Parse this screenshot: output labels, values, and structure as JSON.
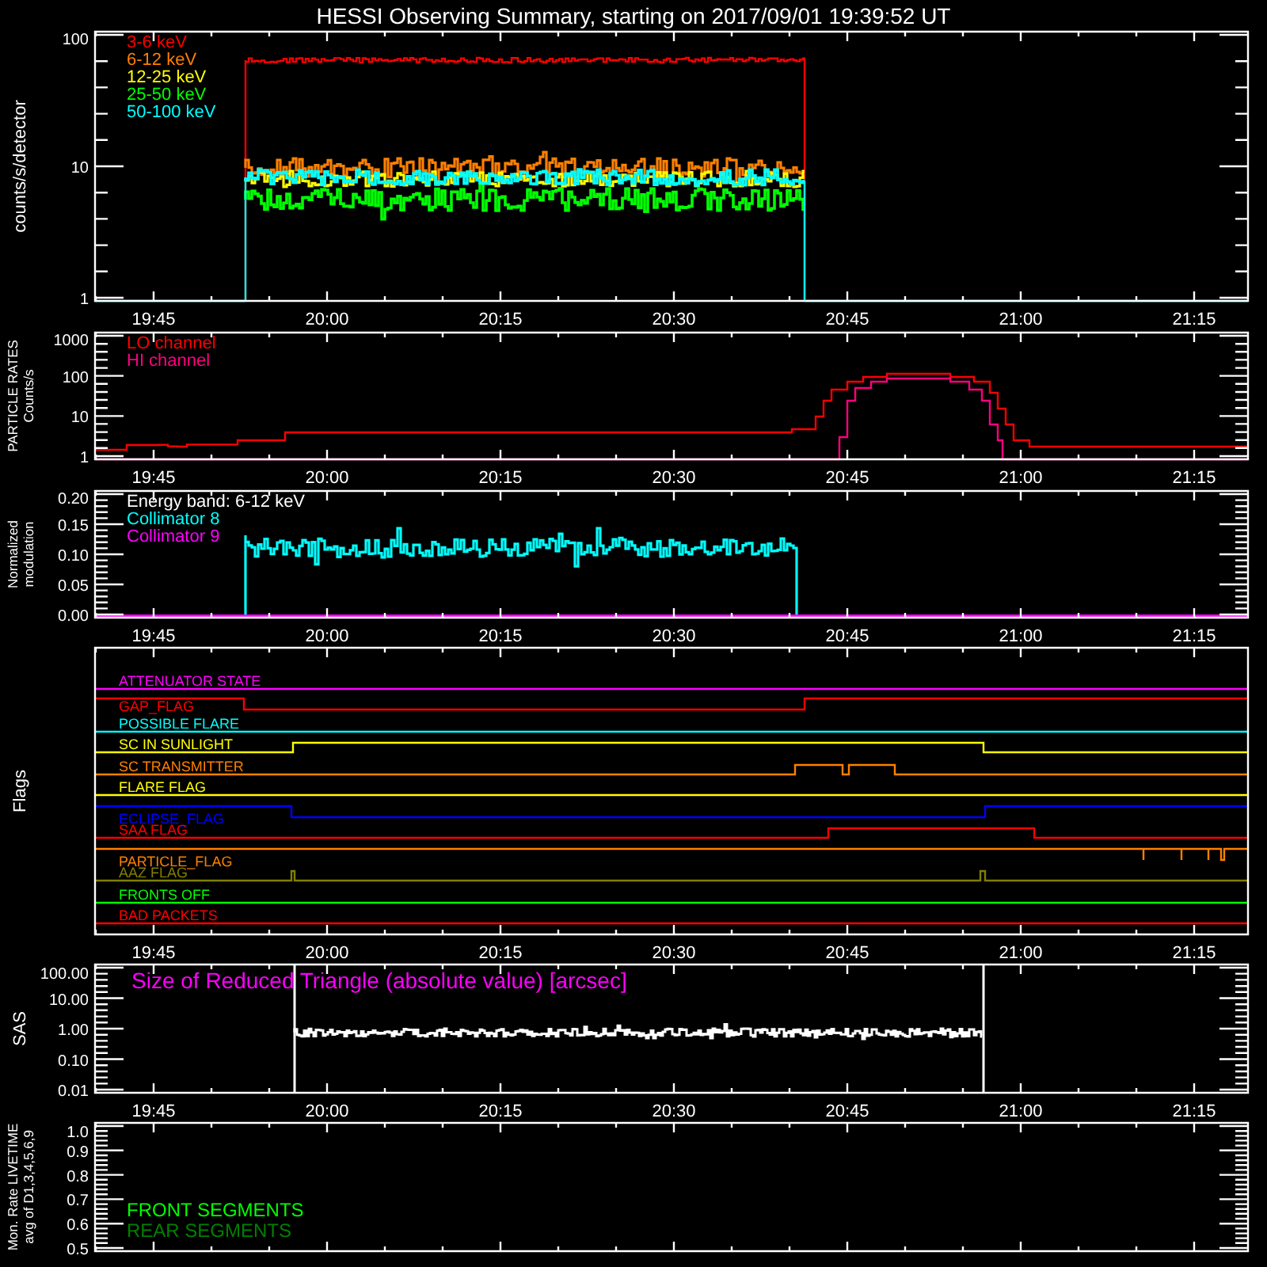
{
  "title": "HESSI Observing Summary, starting on 2017/09/01 19:39:52 UT",
  "panels": [
    {
      "kind": "flux",
      "ylabel": [
        "counts/s/detector"
      ],
      "yticks": [
        "100",
        "10",
        "1"
      ],
      "legend": [
        {
          "label": "3-6 keV",
          "color": "#ff0000"
        },
        {
          "label": "6-12 keV",
          "color": "#ff8000"
        },
        {
          "label": "12-25 keV",
          "color": "#ffff00"
        },
        {
          "label": "25-50 keV",
          "color": "#00ff00"
        },
        {
          "label": "50-100 keV",
          "color": "#00ffff"
        }
      ],
      "time_labels": [
        "19:45",
        "20:00",
        "20:15",
        "20:30",
        "20:45",
        "21:00",
        "21:15"
      ]
    },
    {
      "kind": "particle",
      "ylabel": [
        "PARTICLE RATES",
        "Counts/s"
      ],
      "yticks": [
        "1000",
        "100",
        "10",
        "1"
      ],
      "legend": [
        {
          "label": "LO channel",
          "color": "#ff0000"
        },
        {
          "label": "HI channel",
          "color": "#ff0080"
        }
      ],
      "time_labels": [
        "19:45",
        "20:00",
        "20:15",
        "20:30",
        "20:45",
        "21:00",
        "21:15"
      ]
    },
    {
      "kind": "modulation",
      "ylabel": [
        "Normalized",
        "modulation"
      ],
      "yticks": [
        "0.20",
        "0.15",
        "0.10",
        "0.05",
        "0.00"
      ],
      "legend": [
        {
          "label": "Energy band: 6-12 keV",
          "color": "#ffffff"
        },
        {
          "label": "Collimator 8",
          "color": "#00ffff"
        },
        {
          "label": "Collimator 9",
          "color": "#ff00ff"
        }
      ],
      "time_labels": [
        "19:45",
        "20:00",
        "20:15",
        "20:30",
        "20:45",
        "21:00",
        "21:15"
      ]
    },
    {
      "kind": "flags",
      "ylabel": [
        "Flags"
      ],
      "legend": [
        {
          "label": "ATTENUATOR STATE",
          "color": "#ff00ff"
        },
        {
          "label": "GAP_FLAG",
          "color": "#ff0000"
        },
        {
          "label": "POSSIBLE FLARE",
          "color": "#00ffff"
        },
        {
          "label": "SC IN SUNLIGHT",
          "color": "#ffff00"
        },
        {
          "label": "SC TRANSMITTER",
          "color": "#ff8000"
        },
        {
          "label": "FLARE FLAG",
          "color": "#ffff00"
        },
        {
          "label": "ECLIPSE_FLAG",
          "color": "#0000ff"
        },
        {
          "label": "SAA FLAG",
          "color": "#ff0000"
        },
        {
          "label": "PARTICLE_FLAG",
          "color": "#ff8000"
        },
        {
          "label": "AAZ FLAG",
          "color": "#808000"
        },
        {
          "label": "FRONTS OFF",
          "color": "#00ff00"
        },
        {
          "label": "BAD PACKETS",
          "color": "#ff0000"
        }
      ],
      "time_labels": [
        "19:45",
        "20:00",
        "20:15",
        "20:30",
        "20:45",
        "21:00",
        "21:15"
      ]
    },
    {
      "kind": "sas",
      "ylabel": [
        "SAS"
      ],
      "yticks": [
        "100.00",
        "10.00",
        "1.00",
        "0.10",
        "0.01"
      ],
      "legend": [
        {
          "label": "Size of Reduced Triangle (absolute value) [arcsec]",
          "color": "#ff00ff"
        }
      ],
      "time_labels": [
        "19:45",
        "20:00",
        "20:15",
        "20:30",
        "20:45",
        "21:00",
        "21:15"
      ]
    },
    {
      "kind": "livetime",
      "ylabel": [
        "Mon. Rate LIVETIME",
        "avg of D1,3,4,5,6,9"
      ],
      "yticks": [
        "1.0",
        "0.9",
        "0.8",
        "0.7",
        "0.6",
        "0.5"
      ],
      "legend": [
        {
          "label": "FRONT SEGMENTS",
          "color": "#00ff00"
        },
        {
          "label": "REAR SEGMENTS",
          "color": "#008000"
        }
      ]
    }
  ]
}
